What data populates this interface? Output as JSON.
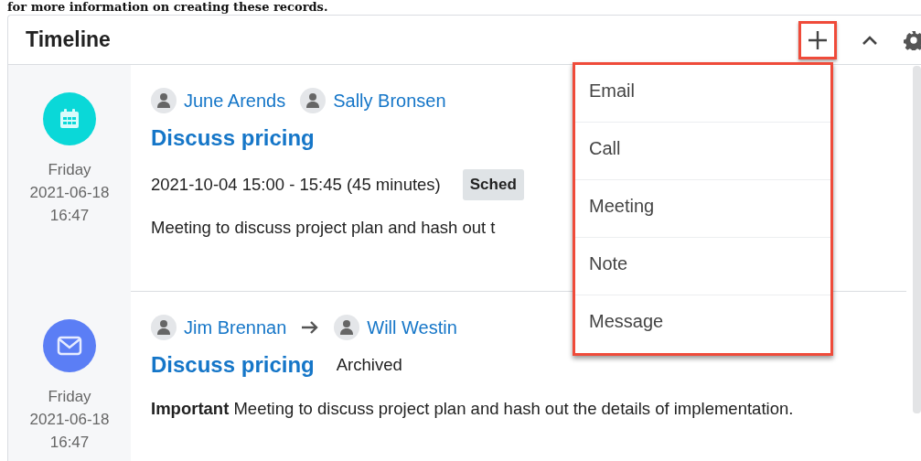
{
  "intro_text": "for more information on creating these records.",
  "panel": {
    "title": "Timeline"
  },
  "add_menu": {
    "expanded": true,
    "items": [
      {
        "label": "Email"
      },
      {
        "label": "Call"
      },
      {
        "label": "Meeting"
      },
      {
        "label": "Note"
      },
      {
        "label": "Message"
      }
    ]
  },
  "entries": [
    {
      "kind": "meeting",
      "day": "Friday",
      "date": "2021-06-18",
      "time": "16:47",
      "participants": [
        {
          "name": "June Arends"
        },
        {
          "name": "Sally Bronsen"
        }
      ],
      "title": "Discuss pricing",
      "time_range": "2021-10-04 15:00 - 15:45 (45 minutes)",
      "status_badge": "Sched",
      "description": "Meeting to discuss project plan and hash out t"
    },
    {
      "kind": "email",
      "day": "Friday",
      "date": "2021-06-18",
      "time": "16:47",
      "participants": [
        {
          "name": "Jim Brennan"
        },
        {
          "name": "Will Westin"
        }
      ],
      "title": "Discuss pricing",
      "status_text": "Archived",
      "description": "**Important** Meeting to discuss project plan and hash out the details of implementation."
    }
  ]
}
